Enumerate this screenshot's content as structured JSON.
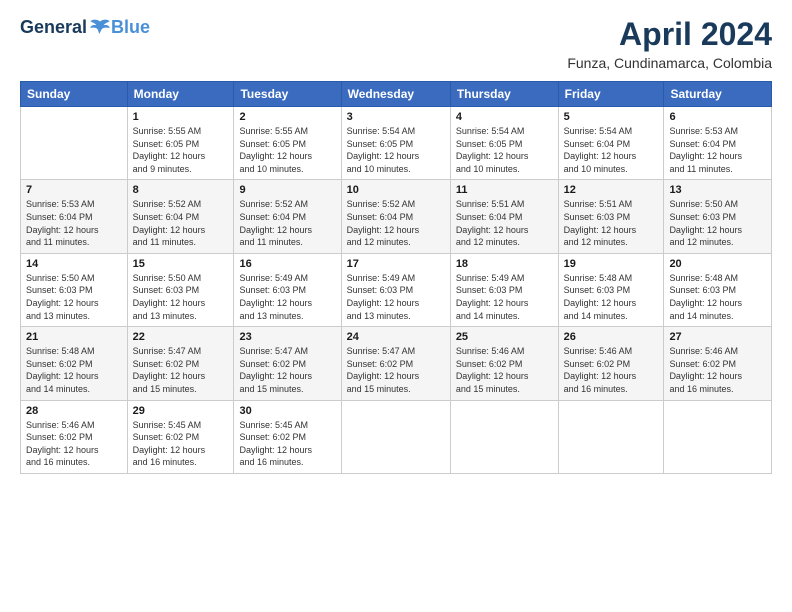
{
  "header": {
    "logo_general": "General",
    "logo_blue": "Blue",
    "month_title": "April 2024",
    "location": "Funza, Cundinamarca, Colombia"
  },
  "columns": [
    "Sunday",
    "Monday",
    "Tuesday",
    "Wednesday",
    "Thursday",
    "Friday",
    "Saturday"
  ],
  "weeks": [
    [
      {
        "day": "",
        "info": ""
      },
      {
        "day": "1",
        "info": "Sunrise: 5:55 AM\nSunset: 6:05 PM\nDaylight: 12 hours\nand 9 minutes."
      },
      {
        "day": "2",
        "info": "Sunrise: 5:55 AM\nSunset: 6:05 PM\nDaylight: 12 hours\nand 10 minutes."
      },
      {
        "day": "3",
        "info": "Sunrise: 5:54 AM\nSunset: 6:05 PM\nDaylight: 12 hours\nand 10 minutes."
      },
      {
        "day": "4",
        "info": "Sunrise: 5:54 AM\nSunset: 6:05 PM\nDaylight: 12 hours\nand 10 minutes."
      },
      {
        "day": "5",
        "info": "Sunrise: 5:54 AM\nSunset: 6:04 PM\nDaylight: 12 hours\nand 10 minutes."
      },
      {
        "day": "6",
        "info": "Sunrise: 5:53 AM\nSunset: 6:04 PM\nDaylight: 12 hours\nand 11 minutes."
      }
    ],
    [
      {
        "day": "7",
        "info": "Sunrise: 5:53 AM\nSunset: 6:04 PM\nDaylight: 12 hours\nand 11 minutes."
      },
      {
        "day": "8",
        "info": "Sunrise: 5:52 AM\nSunset: 6:04 PM\nDaylight: 12 hours\nand 11 minutes."
      },
      {
        "day": "9",
        "info": "Sunrise: 5:52 AM\nSunset: 6:04 PM\nDaylight: 12 hours\nand 11 minutes."
      },
      {
        "day": "10",
        "info": "Sunrise: 5:52 AM\nSunset: 6:04 PM\nDaylight: 12 hours\nand 12 minutes."
      },
      {
        "day": "11",
        "info": "Sunrise: 5:51 AM\nSunset: 6:04 PM\nDaylight: 12 hours\nand 12 minutes."
      },
      {
        "day": "12",
        "info": "Sunrise: 5:51 AM\nSunset: 6:03 PM\nDaylight: 12 hours\nand 12 minutes."
      },
      {
        "day": "13",
        "info": "Sunrise: 5:50 AM\nSunset: 6:03 PM\nDaylight: 12 hours\nand 12 minutes."
      }
    ],
    [
      {
        "day": "14",
        "info": "Sunrise: 5:50 AM\nSunset: 6:03 PM\nDaylight: 12 hours\nand 13 minutes."
      },
      {
        "day": "15",
        "info": "Sunrise: 5:50 AM\nSunset: 6:03 PM\nDaylight: 12 hours\nand 13 minutes."
      },
      {
        "day": "16",
        "info": "Sunrise: 5:49 AM\nSunset: 6:03 PM\nDaylight: 12 hours\nand 13 minutes."
      },
      {
        "day": "17",
        "info": "Sunrise: 5:49 AM\nSunset: 6:03 PM\nDaylight: 12 hours\nand 13 minutes."
      },
      {
        "day": "18",
        "info": "Sunrise: 5:49 AM\nSunset: 6:03 PM\nDaylight: 12 hours\nand 14 minutes."
      },
      {
        "day": "19",
        "info": "Sunrise: 5:48 AM\nSunset: 6:03 PM\nDaylight: 12 hours\nand 14 minutes."
      },
      {
        "day": "20",
        "info": "Sunrise: 5:48 AM\nSunset: 6:03 PM\nDaylight: 12 hours\nand 14 minutes."
      }
    ],
    [
      {
        "day": "21",
        "info": "Sunrise: 5:48 AM\nSunset: 6:02 PM\nDaylight: 12 hours\nand 14 minutes."
      },
      {
        "day": "22",
        "info": "Sunrise: 5:47 AM\nSunset: 6:02 PM\nDaylight: 12 hours\nand 15 minutes."
      },
      {
        "day": "23",
        "info": "Sunrise: 5:47 AM\nSunset: 6:02 PM\nDaylight: 12 hours\nand 15 minutes."
      },
      {
        "day": "24",
        "info": "Sunrise: 5:47 AM\nSunset: 6:02 PM\nDaylight: 12 hours\nand 15 minutes."
      },
      {
        "day": "25",
        "info": "Sunrise: 5:46 AM\nSunset: 6:02 PM\nDaylight: 12 hours\nand 15 minutes."
      },
      {
        "day": "26",
        "info": "Sunrise: 5:46 AM\nSunset: 6:02 PM\nDaylight: 12 hours\nand 16 minutes."
      },
      {
        "day": "27",
        "info": "Sunrise: 5:46 AM\nSunset: 6:02 PM\nDaylight: 12 hours\nand 16 minutes."
      }
    ],
    [
      {
        "day": "28",
        "info": "Sunrise: 5:46 AM\nSunset: 6:02 PM\nDaylight: 12 hours\nand 16 minutes."
      },
      {
        "day": "29",
        "info": "Sunrise: 5:45 AM\nSunset: 6:02 PM\nDaylight: 12 hours\nand 16 minutes."
      },
      {
        "day": "30",
        "info": "Sunrise: 5:45 AM\nSunset: 6:02 PM\nDaylight: 12 hours\nand 16 minutes."
      },
      {
        "day": "",
        "info": ""
      },
      {
        "day": "",
        "info": ""
      },
      {
        "day": "",
        "info": ""
      },
      {
        "day": "",
        "info": ""
      }
    ]
  ]
}
